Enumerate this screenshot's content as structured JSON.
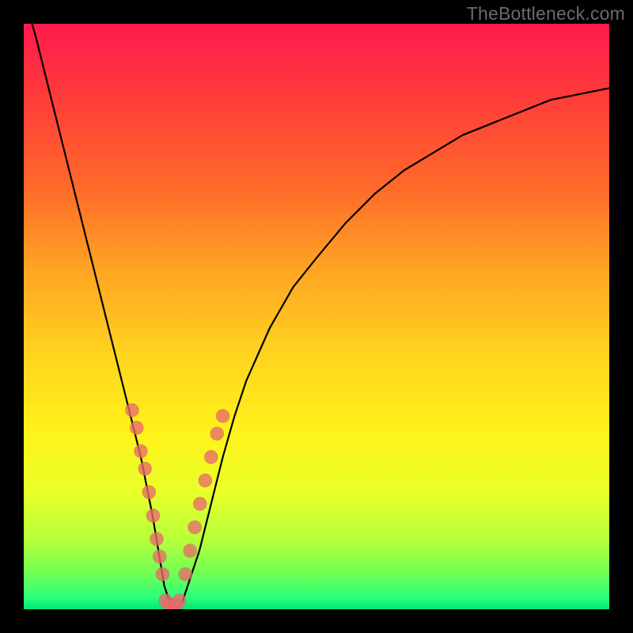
{
  "watermark": {
    "text": "TheBottleneck.com"
  },
  "colors": {
    "frame": "#000000",
    "curve": "#000000",
    "dot": "#e86a6a",
    "gradient_top": "#ff1a4d",
    "gradient_bottom": "#00e676"
  },
  "chart_data": {
    "type": "line",
    "title": "",
    "xlabel": "",
    "ylabel": "",
    "xlim": [
      0,
      100
    ],
    "ylim": [
      0,
      100
    ],
    "grid": false,
    "series": [
      {
        "name": "bottleneck-curve",
        "x": [
          0,
          2,
          4,
          6,
          8,
          10,
          12,
          14,
          16,
          18,
          20,
          22,
          23,
          24,
          25,
          26,
          27,
          28,
          30,
          32,
          34,
          36,
          38,
          42,
          46,
          50,
          55,
          60,
          65,
          70,
          75,
          80,
          85,
          90,
          95,
          100
        ],
        "y": [
          105,
          98,
          90,
          82,
          74,
          66,
          58,
          50,
          42,
          34,
          26,
          16,
          10,
          4,
          1,
          0,
          1,
          4,
          10,
          18,
          26,
          33,
          39,
          48,
          55,
          60,
          66,
          71,
          75,
          78,
          81,
          83,
          85,
          87,
          88,
          89
        ]
      }
    ],
    "markers": [
      {
        "name": "left-branch-dots",
        "points": [
          {
            "x": 18.5,
            "y": 34
          },
          {
            "x": 19.3,
            "y": 31
          },
          {
            "x": 20.0,
            "y": 27
          },
          {
            "x": 20.7,
            "y": 24
          },
          {
            "x": 21.4,
            "y": 20
          },
          {
            "x": 22.1,
            "y": 16
          },
          {
            "x": 22.7,
            "y": 12
          },
          {
            "x": 23.2,
            "y": 9
          },
          {
            "x": 23.7,
            "y": 6
          }
        ]
      },
      {
        "name": "bottom-dots",
        "points": [
          {
            "x": 24.2,
            "y": 1.5
          },
          {
            "x": 24.8,
            "y": 0.8
          },
          {
            "x": 25.4,
            "y": 0.6
          },
          {
            "x": 26.0,
            "y": 0.8
          },
          {
            "x": 26.6,
            "y": 1.5
          }
        ]
      },
      {
        "name": "right-branch-dots",
        "points": [
          {
            "x": 27.6,
            "y": 6
          },
          {
            "x": 28.4,
            "y": 10
          },
          {
            "x": 29.2,
            "y": 14
          },
          {
            "x": 30.1,
            "y": 18
          },
          {
            "x": 31.0,
            "y": 22
          },
          {
            "x": 32.0,
            "y": 26
          },
          {
            "x": 33.0,
            "y": 30
          },
          {
            "x": 34.0,
            "y": 33
          }
        ]
      }
    ]
  }
}
